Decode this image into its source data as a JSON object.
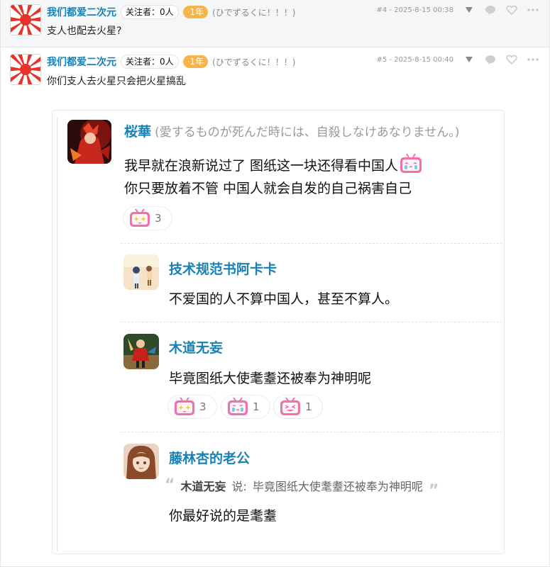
{
  "posts": [
    {
      "username": "我们都爱二次元",
      "follow": "关注者：0人",
      "year": "·1年",
      "motto": "(ひでずるくに！！！)",
      "floor": "#4 - 2025-8-15 00:38",
      "content": "支人也配去火星?"
    },
    {
      "username": "我们都爱二次元",
      "follow": "关注者：0人",
      "year": "·1年",
      "motto": "(ひでずるくに！！！)",
      "floor": "#5 - 2025-8-15 00:40",
      "content": "你们支人去火星只会把火星搞乱"
    }
  ],
  "icons": {
    "dropdown": "chevron-down-icon",
    "comment": "comment-bubble-icon",
    "like": "heart-icon",
    "more": "more-dots-icon",
    "sticker_sparkle": "bilibili-tv-sparkle-icon",
    "sticker_cry": "bilibili-tv-cry-icon",
    "sticker_grin": "bilibili-tv-grin-icon"
  },
  "thread": {
    "main": {
      "name": "桜華",
      "signature": "(愛するものが死んだ時には、自殺しなけあなりません。)",
      "lines": [
        "我早就在浪新说过了 图纸这一块还得看中国人",
        "你只要放着不管 中国人就会自发的自己祸害自己"
      ],
      "reaction_count": "3"
    },
    "replies": [
      {
        "name": "技术规范书阿卡卡",
        "text": "不爱国的人不算中国人，甚至不算人。"
      },
      {
        "name": "木道无妄",
        "text": "毕竟图纸大使耄耋还被奉为神明呢",
        "reactions": [
          "3",
          "1",
          "1"
        ]
      },
      {
        "name": "藤林杏的老公",
        "quote_author": "木道无妄",
        "quote_said": "说:",
        "quote_text": "毕竟图纸大使耄耋还被奉为神明呢",
        "text": "你最好说的是耄耋"
      }
    ]
  },
  "colors": {
    "username": "#1781b5",
    "year_badge": "#f7b44a",
    "sticker_pink": "#f26fa9"
  }
}
